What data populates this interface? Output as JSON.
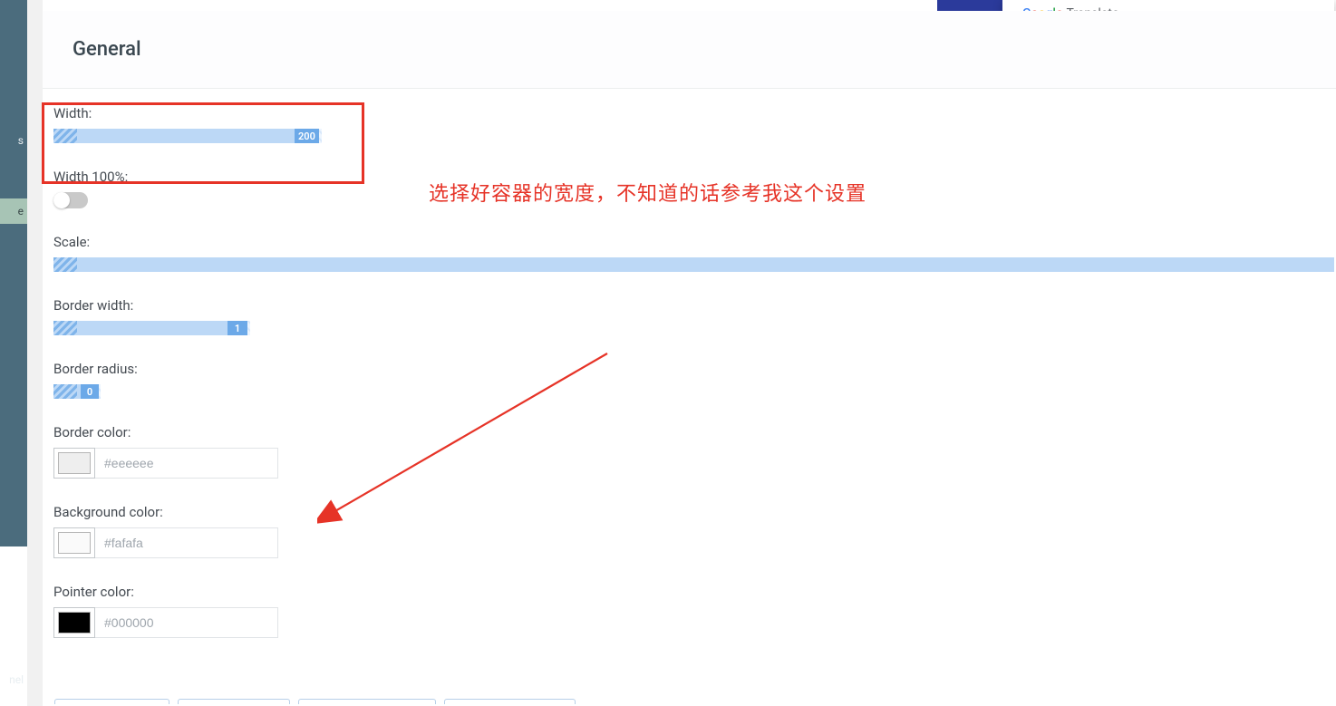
{
  "sidebar": {
    "partial_labels": [
      "s",
      "nel"
    ],
    "active_tab_suffix": "e"
  },
  "translate_popup": {
    "brand": "Google",
    "product": "Translate"
  },
  "section": {
    "title": "General"
  },
  "annotation_text": "选择好容器的宽度，不知道的话参考我这个设置",
  "fields": {
    "width": {
      "label": "Width:",
      "value": "200"
    },
    "width_full": {
      "label": "Width 100%:",
      "on": false
    },
    "scale": {
      "label": "Scale:"
    },
    "border_width": {
      "label": "Border width:",
      "value": "1"
    },
    "border_radius": {
      "label": "Border radius:",
      "value": "0"
    },
    "border_color": {
      "label": "Border color:",
      "placeholder": "#eeeeee",
      "swatch": "#eeeeee"
    },
    "background_color": {
      "label": "Background color:",
      "placeholder": "#fafafa",
      "swatch": "#fafafa"
    },
    "pointer_color": {
      "label": "Pointer color:",
      "placeholder": "#000000",
      "swatch": "#000000"
    }
  }
}
